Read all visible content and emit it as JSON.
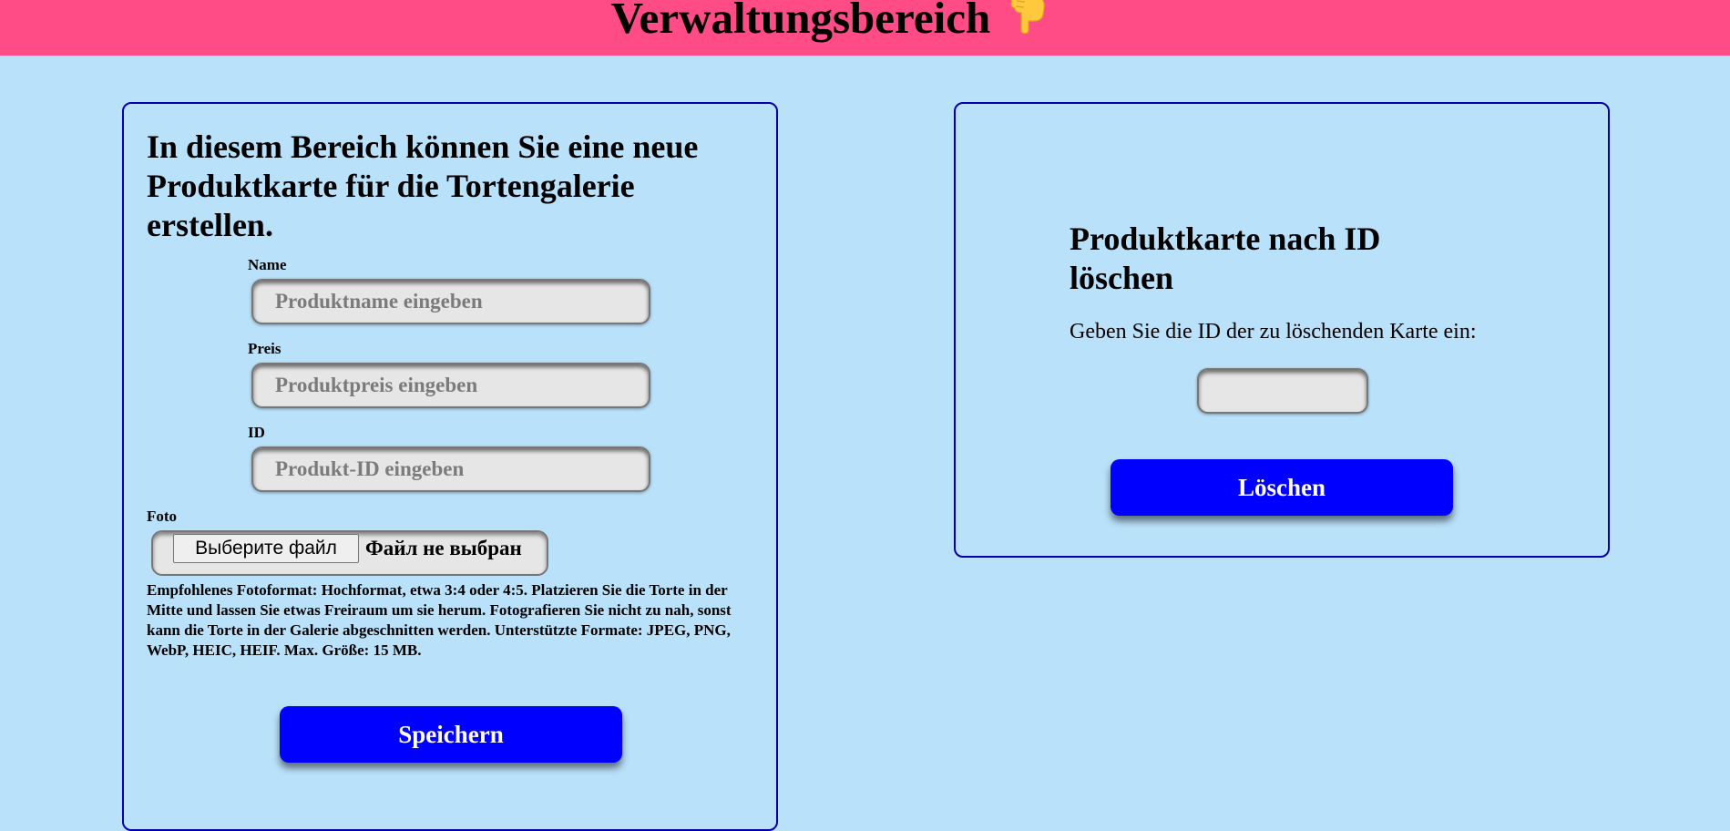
{
  "header": {
    "title": "Verwaltungsbereich",
    "icon": "pointing-down-hand-icon"
  },
  "create_form": {
    "heading": "In diesem Bereich können Sie eine neue Produktkarte für die Tortengalerie erstellen.",
    "name_label": "Name",
    "name_placeholder": "Produktname eingeben",
    "name_value": "",
    "price_label": "Preis",
    "price_placeholder": "Produktpreis eingeben",
    "price_value": "",
    "id_label": "ID",
    "id_placeholder": "Produkt-ID eingeben",
    "id_value": "",
    "photo_label": "Foto",
    "file_button_label": "Выберите файл",
    "file_status": "Файл не выбран",
    "hint": "Empfohlenes Fotoformat: Hochformat, etwa 3:4 oder 4:5. Platzieren Sie die Torte in der Mitte und lassen Sie etwas Freiraum um sie herum. Fotografieren Sie nicht zu nah, sonst kann die Torte in der Galerie abgeschnitten werden. Unterstützte Formate: JPEG, PNG, WebP, HEIC, HEIF. Max. Größe: 15 MB.",
    "save_label": "Speichern"
  },
  "delete_form": {
    "heading": "Produktkarte nach ID löschen",
    "description": "Geben Sie die ID der zu löschenden Karte ein:",
    "id_value": "",
    "delete_label": "Löschen"
  },
  "colors": {
    "page_background": "#bae1fa",
    "header_background": "#ff4b86",
    "button_background": "#0000ff",
    "panel_border": "#0000aa",
    "input_background": "#e6e6e6"
  }
}
